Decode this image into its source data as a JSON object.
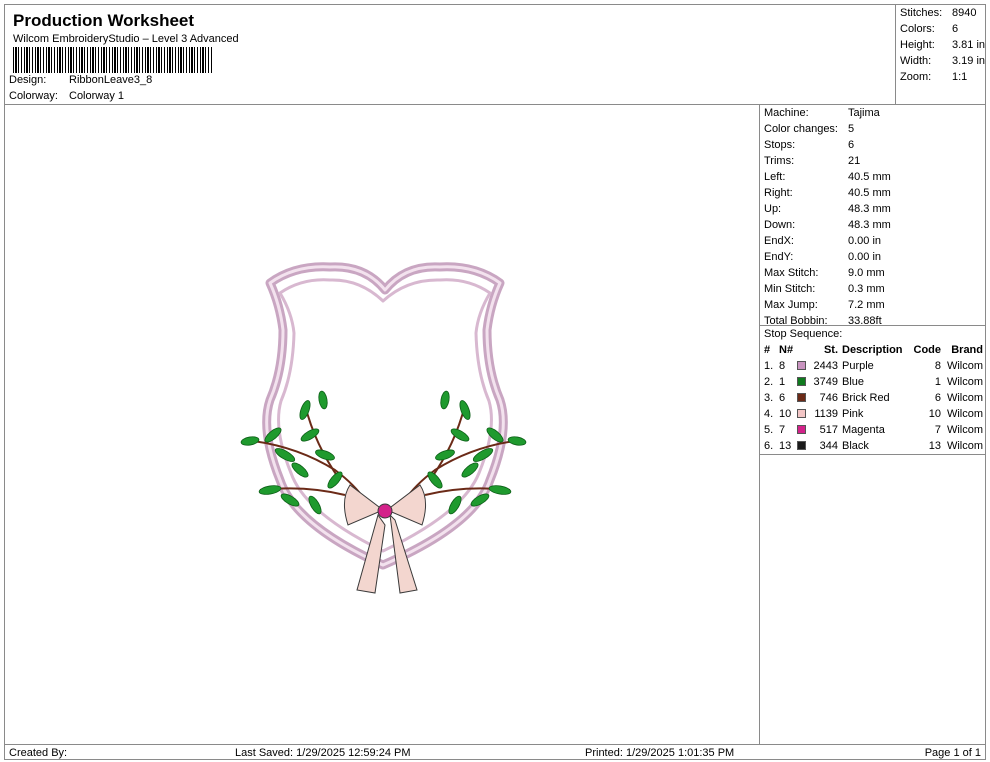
{
  "header": {
    "title": "Production Worksheet",
    "software": "Wilcom EmbroideryStudio – Level 3 Advanced",
    "design_label": "Design:",
    "design_value": "RibbonLeave3_8",
    "colorway_label": "Colorway:",
    "colorway_value": "Colorway 1"
  },
  "summary": [
    {
      "label": "Stitches:",
      "value": "8940"
    },
    {
      "label": "Colors:",
      "value": "6"
    },
    {
      "label": "Height:",
      "value": "3.81 in"
    },
    {
      "label": "Width:",
      "value": "3.19 in"
    },
    {
      "label": "Zoom:",
      "value": "1:1"
    }
  ],
  "machine_info": [
    {
      "label": "Machine:",
      "value": "Tajima"
    },
    {
      "label": "Color changes:",
      "value": "5"
    },
    {
      "label": "Stops:",
      "value": "6"
    },
    {
      "label": "Trims:",
      "value": "21"
    },
    {
      "label": "Left:",
      "value": "40.5 mm"
    },
    {
      "label": "Right:",
      "value": "40.5 mm"
    },
    {
      "label": "Up:",
      "value": "48.3 mm"
    },
    {
      "label": "Down:",
      "value": "48.3 mm"
    },
    {
      "label": "EndX:",
      "value": "0.00 in"
    },
    {
      "label": "EndY:",
      "value": "0.00 in"
    },
    {
      "label": "Max Stitch:",
      "value": "9.0 mm"
    },
    {
      "label": "Min Stitch:",
      "value": "0.3 mm"
    },
    {
      "label": "Max Jump:",
      "value": "7.2 mm"
    },
    {
      "label": "Total Bobbin:",
      "value": "33.88ft"
    }
  ],
  "stop_sequence": {
    "title": "Stop Sequence:",
    "headers": {
      "num": "#",
      "n": "N#",
      "st": "St.",
      "desc": "Description",
      "code": "Code",
      "brand": "Brand"
    },
    "rows": [
      {
        "num": "1.",
        "n": "8",
        "color": "#c994c0",
        "st": "2443",
        "desc": "Purple",
        "code": "8",
        "brand": "Wilcom"
      },
      {
        "num": "2.",
        "n": "1",
        "color": "#0f7a1e",
        "st": "3749",
        "desc": "Blue",
        "code": "1",
        "brand": "Wilcom"
      },
      {
        "num": "3.",
        "n": "6",
        "color": "#6b2a17",
        "st": "746",
        "desc": "Brick Red",
        "code": "6",
        "brand": "Wilcom"
      },
      {
        "num": "4.",
        "n": "10",
        "color": "#f3c6c6",
        "st": "1139",
        "desc": "Pink",
        "code": "10",
        "brand": "Wilcom"
      },
      {
        "num": "5.",
        "n": "7",
        "color": "#d3228a",
        "st": "517",
        "desc": "Magenta",
        "code": "7",
        "brand": "Wilcom"
      },
      {
        "num": "6.",
        "n": "13",
        "color": "#1a1a1a",
        "st": "344",
        "desc": "Black",
        "code": "13",
        "brand": "Wilcom"
      }
    ]
  },
  "footer": {
    "created_by": "Created By:",
    "last_saved": "Last Saved: 1/29/2025 12:59:24 PM",
    "printed": "Printed: 1/29/2025 1:01:35 PM",
    "page": "Page 1 of 1"
  }
}
